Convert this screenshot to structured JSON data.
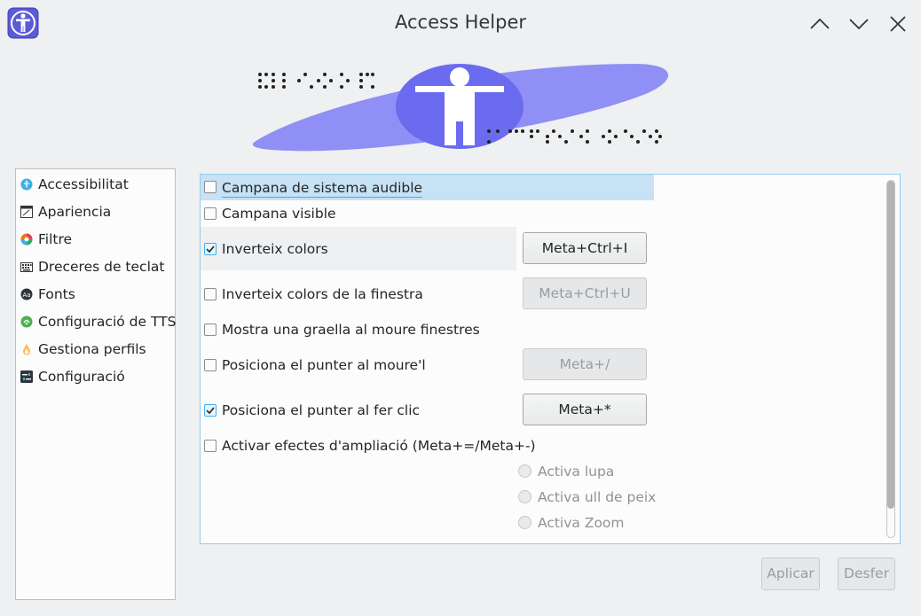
{
  "window": {
    "title": "Access Helper",
    "icon": "accessibility-icon",
    "controls": [
      "chevron-up-icon",
      "chevron-down-icon",
      "close-icon"
    ]
  },
  "sidebar": {
    "items": [
      {
        "label": "Accessibilitat",
        "icon": "accessibility-icon"
      },
      {
        "label": "Apariencia",
        "icon": "appearance-icon"
      },
      {
        "label": "Filtre",
        "icon": "color-filter-icon"
      },
      {
        "label": "Dreceres de teclat",
        "icon": "keyboard-icon"
      },
      {
        "label": "Fonts",
        "icon": "font-icon"
      },
      {
        "label": "Configuració de TTS",
        "icon": "tts-icon"
      },
      {
        "label": "Gestiona perfils",
        "icon": "profile-icon"
      },
      {
        "label": "Configuració",
        "icon": "settings-icon"
      }
    ]
  },
  "options": [
    {
      "label": "Campana de sistema audible",
      "checked": false
    },
    {
      "label": "Campana visible",
      "checked": false
    },
    {
      "label": "Inverteix colors",
      "checked": true,
      "shortcut": "Meta+Ctrl+I",
      "shortcut_enabled": true
    },
    {
      "label": "Inverteix colors de la finestra",
      "checked": false,
      "shortcut": "Meta+Ctrl+U",
      "shortcut_enabled": false
    },
    {
      "label": "Mostra una graella al moure finestres",
      "checked": false
    },
    {
      "label": "Posiciona el punter al moure'l",
      "checked": false,
      "shortcut": "Meta+/",
      "shortcut_enabled": false
    },
    {
      "label": "Posiciona el punter al fer clic",
      "checked": true,
      "shortcut": "Meta+*",
      "shortcut_enabled": true
    },
    {
      "label": "Activar efectes d'ampliació (Meta+=/Meta+-)",
      "checked": false
    }
  ],
  "zoom_modes": [
    {
      "label": "Activa lupa",
      "enabled": false
    },
    {
      "label": "Activa ull de peix",
      "enabled": false
    },
    {
      "label": "Activa Zoom",
      "enabled": false
    }
  ],
  "footer": {
    "apply_label": "Aplicar",
    "undo_label": "Desfer"
  },
  "colors": {
    "accent": "#3daee9",
    "banner": "#8f8ff5",
    "banner_circle": "#6b6bf0"
  }
}
